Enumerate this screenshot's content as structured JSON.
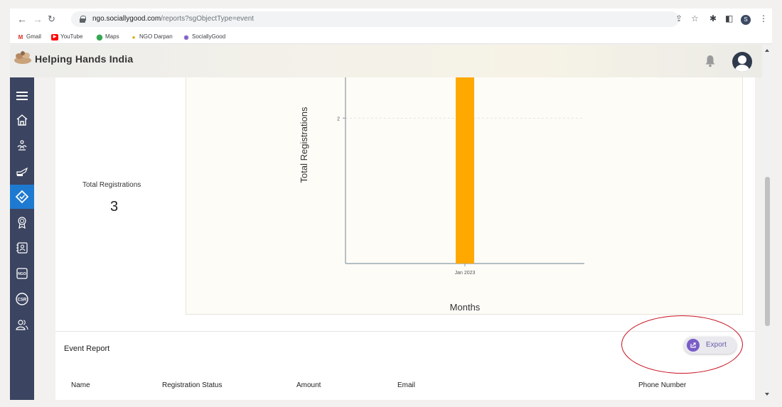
{
  "browser": {
    "url_host": "ngo.sociallygood.com",
    "url_path": "/reports?sgObjectType=event",
    "profile_initial": "S",
    "bookmarks": [
      {
        "label": "Gmail",
        "icon": "gmail-icon",
        "color": "#d93025"
      },
      {
        "label": "YouTube",
        "icon": "youtube-icon",
        "color": "#ff0000"
      },
      {
        "label": "Maps",
        "icon": "maps-icon",
        "color": "#34a853"
      },
      {
        "label": "NGO Darpan",
        "icon": "ngo-darpan-icon",
        "color": "#e0a800"
      },
      {
        "label": "SociallyGood",
        "icon": "sociallygood-icon",
        "color": "#7a5cc6"
      }
    ]
  },
  "app": {
    "title": "Helping Hands India"
  },
  "sidebar": {
    "items": [
      {
        "icon": "menu-icon",
        "active": false
      },
      {
        "icon": "home-icon",
        "active": false
      },
      {
        "icon": "volunteer-icon",
        "active": false
      },
      {
        "icon": "donation-icon",
        "active": false
      },
      {
        "icon": "events-icon",
        "active": true
      },
      {
        "icon": "awards-icon",
        "active": false
      },
      {
        "icon": "contacts-icon",
        "active": false
      },
      {
        "icon": "ngo-icon",
        "active": false
      },
      {
        "icon": "csr-icon",
        "active": false
      },
      {
        "icon": "users-icon",
        "active": false
      }
    ],
    "accent": "#1e7ad1"
  },
  "stats": {
    "label": "Total Registrations",
    "value": "3"
  },
  "chart_data": {
    "type": "bar",
    "categories": [
      "Jan 2023"
    ],
    "values": [
      3
    ],
    "ylabel": "Total Registrations",
    "xlabel": "Months",
    "yticks": [
      "2"
    ],
    "bar_color": "#ffa800"
  },
  "report": {
    "title": "Event Report",
    "export_label": "Export",
    "columns": [
      "Name",
      "Registration Status",
      "Amount",
      "Email",
      "Phone Number"
    ]
  }
}
